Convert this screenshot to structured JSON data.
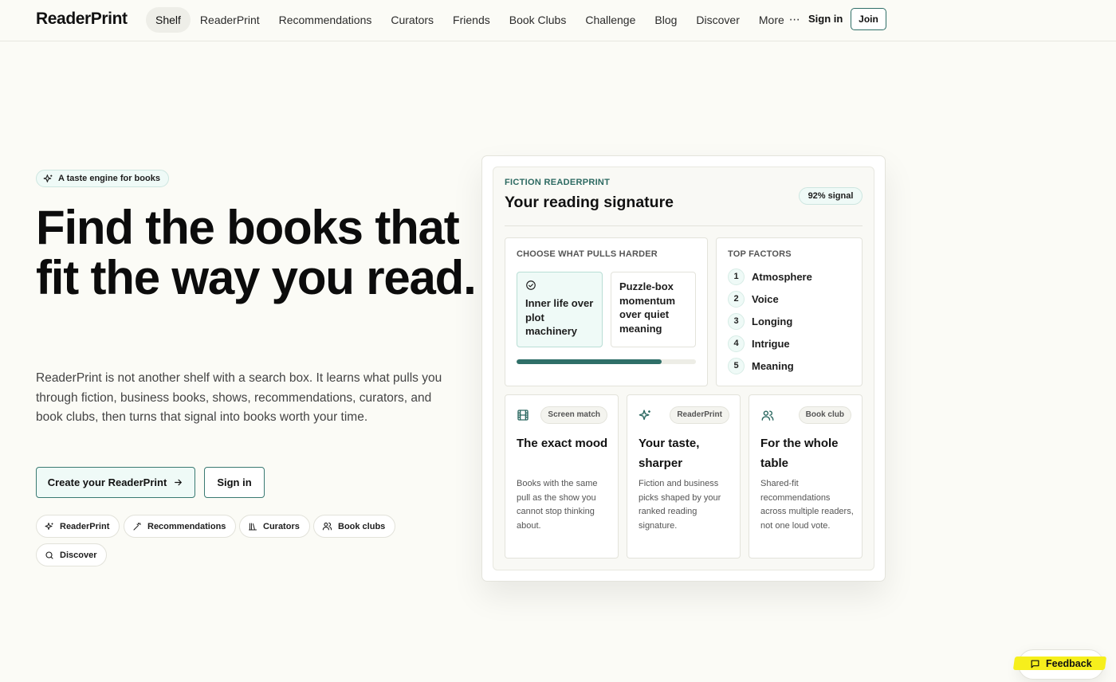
{
  "header": {
    "brand": "ReaderPrint",
    "nav": [
      {
        "label": "Shelf",
        "active": true
      },
      {
        "label": "ReaderPrint"
      },
      {
        "label": "Recommendations"
      },
      {
        "label": "Curators"
      },
      {
        "label": "Friends"
      },
      {
        "label": "Book Clubs"
      },
      {
        "label": "Challenge"
      },
      {
        "label": "Blog"
      },
      {
        "label": "Discover"
      },
      {
        "label": "More"
      }
    ],
    "signin": "Sign in",
    "join": "Join"
  },
  "hero": {
    "tag": "A taste engine for books",
    "title": "Find the books that fit the way you read.",
    "description": "ReaderPrint is not another shelf with a search box. It learns what pulls you through fiction, business books, shows, recommendations, curators, and book clubs, then turns that signal into books worth your time.",
    "cta_primary": "Create your ReaderPrint",
    "cta_secondary": "Sign in",
    "chips": [
      "ReaderPrint",
      "Recommendations",
      "Curators",
      "Book clubs",
      "Discover"
    ]
  },
  "card": {
    "eyebrow": "FICTION READERPRINT",
    "title": "Your reading signature",
    "signal": "92% signal",
    "choose_label": "CHOOSE WHAT PULLS HARDER",
    "option_selected": "Inner life over plot machinery",
    "option_other": "Puzzle-box momentum over quiet meaning",
    "pull_progress": 0.81,
    "factors_label": "TOP FACTORS",
    "factors": [
      {
        "num": "1",
        "label": "Atmosphere"
      },
      {
        "num": "2",
        "label": "Voice"
      },
      {
        "num": "3",
        "label": "Longing"
      },
      {
        "num": "4",
        "label": "Intrigue"
      },
      {
        "num": "5",
        "label": "Meaning"
      }
    ],
    "features": [
      {
        "badge": "Screen match",
        "title": "The exact mood",
        "desc": "Books with the same pull as the show you cannot stop thinking about.",
        "icon": "film-icon"
      },
      {
        "badge": "ReaderPrint",
        "title": "Your taste, sharper",
        "desc": "Fiction and business picks shaped by your ranked reading signature.",
        "icon": "sparkle-icon"
      },
      {
        "badge": "Book club",
        "title": "For the whole table",
        "desc": "Shared-fit recommendations across multiple readers, not one loud vote.",
        "icon": "users-icon"
      }
    ]
  },
  "feedback": "Feedback",
  "colors": {
    "accent": "#2f6f68",
    "accent_light": "#effaf7",
    "background": "#fbfbf6",
    "highlight": "#f6ef1c"
  }
}
